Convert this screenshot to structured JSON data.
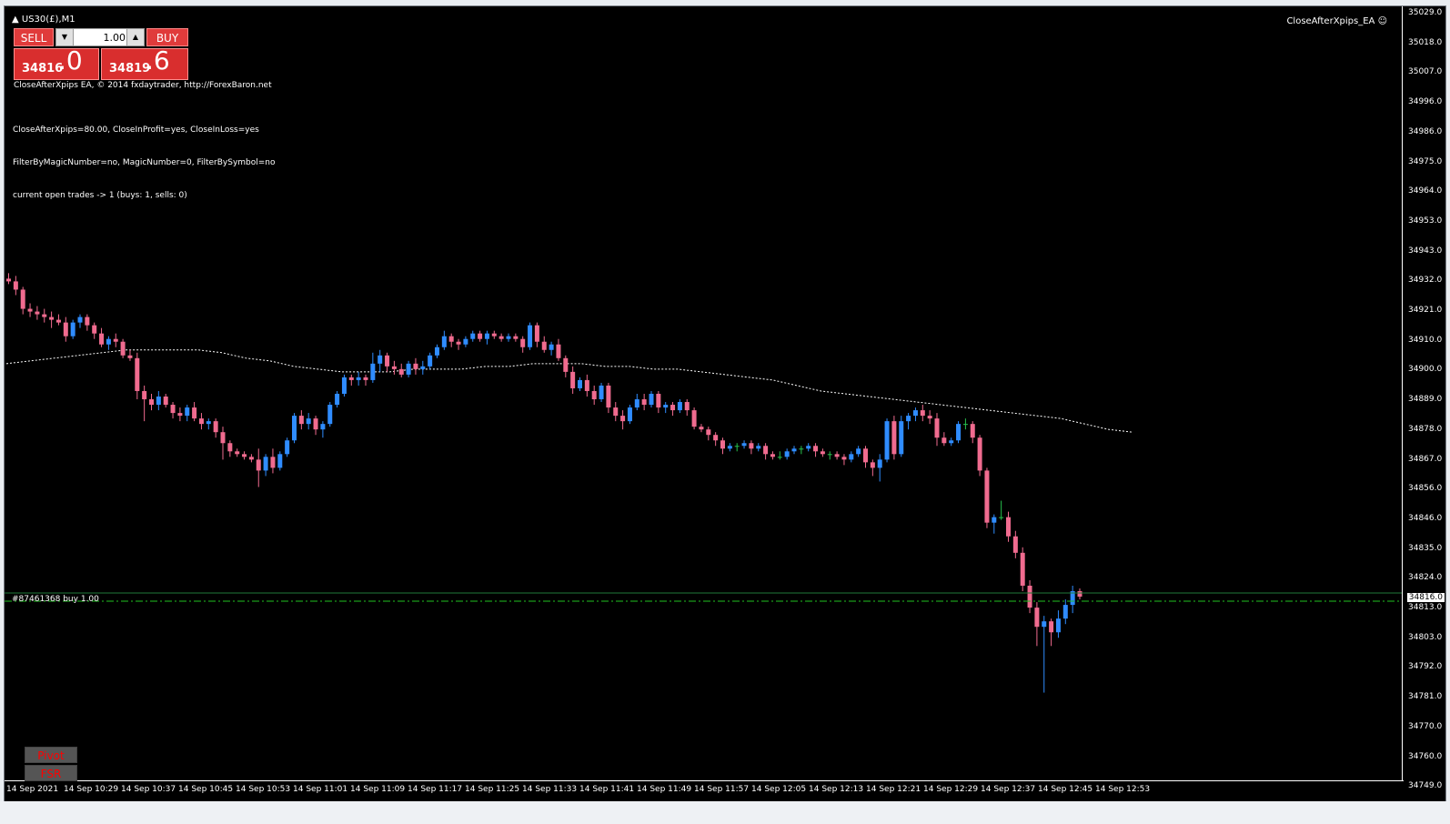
{
  "window": {
    "symbol_title": "US30(£),M1",
    "ea_label": "CloseAfterXpips_EA ☺"
  },
  "trade_panel": {
    "sell_label": "SELL",
    "buy_label": "BUY",
    "lot_value": "1.00",
    "sell_quote_main": "34816",
    "sell_quote_big": ".0",
    "buy_quote_main": "34819",
    "buy_quote_big": ".6"
  },
  "ea_info": {
    "line1": "CloseAfterXpips EA, © 2014 fxdaytrader, http://ForexBaron.net",
    "params1": "CloseAfterXpips=80.00, CloseInProfit=yes, CloseInLoss=yes",
    "params2": "FilterByMagicNumber=no, MagicNumber=0, FilterBySymbol=no",
    "params3": "current open trades -> 1 (buys: 1, sells: 0)"
  },
  "order_line": {
    "label": "#87461368 buy 1.00",
    "current_price": "34816.0"
  },
  "price_axis": [
    "35029.0",
    "35018.0",
    "35007.0",
    "34996.0",
    "34986.0",
    "34975.0",
    "34964.0",
    "34953.0",
    "34943.0",
    "34932.0",
    "34921.0",
    "34910.0",
    "34900.0",
    "34889.0",
    "34878.0",
    "34867.0",
    "34856.0",
    "34846.0",
    "34835.0",
    "34824.0",
    "34813.0",
    "34803.0",
    "34792.0",
    "34781.0",
    "34770.0",
    "34760.0",
    "34749.0"
  ],
  "time_axis": [
    "14 Sep 2021",
    "14 Sep 10:29",
    "14 Sep 10:37",
    "14 Sep 10:45",
    "14 Sep 10:53",
    "14 Sep 11:01",
    "14 Sep 11:09",
    "14 Sep 11:17",
    "14 Sep 11:25",
    "14 Sep 11:33",
    "14 Sep 11:41",
    "14 Sep 11:49",
    "14 Sep 11:57",
    "14 Sep 12:05",
    "14 Sep 12:13",
    "14 Sep 12:21",
    "14 Sep 12:29",
    "14 Sep 12:37",
    "14 Sep 12:45",
    "14 Sep 12:53"
  ],
  "indicators": {
    "pivot": "Pivot",
    "fsr": "FSR"
  },
  "colors": {
    "bull": "#2f8cff",
    "bear": "#f06b8f",
    "doji": "#27c24d",
    "order_line": "#20c020",
    "ma_line": "#ffffff"
  },
  "chart_data": {
    "type": "candlestick",
    "ohlc": [
      [
        34932,
        34934,
        34930,
        34931
      ],
      [
        34931,
        34933,
        34926,
        34928
      ],
      [
        34928,
        34929,
        34919,
        34921
      ],
      [
        34921,
        34923,
        34918,
        34920
      ],
      [
        34920,
        34922,
        34917,
        34919
      ],
      [
        34919,
        34921,
        34916,
        34918
      ],
      [
        34918,
        34920,
        34914,
        34917
      ],
      [
        34917,
        34919,
        34915,
        34916
      ],
      [
        34916,
        34918,
        34909,
        34911
      ],
      [
        34911,
        34917,
        34910,
        34916
      ],
      [
        34916,
        34919,
        34914,
        34918
      ],
      [
        34918,
        34919,
        34913,
        34915
      ],
      [
        34915,
        34916,
        34910,
        34912
      ],
      [
        34912,
        34914,
        34907,
        34908
      ],
      [
        34908,
        34911,
        34906,
        34910
      ],
      [
        34910,
        34912,
        34907,
        34909
      ],
      [
        34909,
        34910,
        34903,
        34904
      ],
      [
        34904,
        34906,
        34902,
        34903
      ],
      [
        34903,
        34905,
        34888,
        34891
      ],
      [
        34891,
        34893,
        34880,
        34888
      ],
      [
        34888,
        34890,
        34884,
        34886
      ],
      [
        34886,
        34891,
        34884,
        34889
      ],
      [
        34889,
        34890,
        34885,
        34886
      ],
      [
        34886,
        34887,
        34881,
        34883
      ],
      [
        34883,
        34885,
        34880,
        34882
      ],
      [
        34882,
        34886,
        34880,
        34885
      ],
      [
        34885,
        34887,
        34880,
        34881
      ],
      [
        34881,
        34883,
        34877,
        34879
      ],
      [
        34879,
        34881,
        34877,
        34880
      ],
      [
        34880,
        34881,
        34874,
        34876
      ],
      [
        34876,
        34878,
        34866,
        34872
      ],
      [
        34872,
        34873,
        34867,
        34869
      ],
      [
        34869,
        34870,
        34867,
        34868
      ],
      [
        34868,
        34869,
        34866,
        34867
      ],
      [
        34867,
        34868,
        34865,
        34866
      ],
      [
        34866,
        34870,
        34856,
        34862
      ],
      [
        34862,
        34868,
        34860,
        34867
      ],
      [
        34867,
        34870,
        34861,
        34863
      ],
      [
        34863,
        34869,
        34862,
        34868
      ],
      [
        34868,
        34874,
        34867,
        34873
      ],
      [
        34873,
        34883,
        34872,
        34882
      ],
      [
        34882,
        34884,
        34877,
        34879
      ],
      [
        34879,
        34883,
        34877,
        34881
      ],
      [
        34881,
        34882,
        34875,
        34877
      ],
      [
        34877,
        34880,
        34874,
        34879
      ],
      [
        34879,
        34887,
        34878,
        34886
      ],
      [
        34886,
        34891,
        34885,
        34890
      ],
      [
        34890,
        34897,
        34889,
        34896
      ],
      [
        34896,
        34897,
        34893,
        34895
      ],
      [
        34895,
        34898,
        34893,
        34896
      ],
      [
        34896,
        34897,
        34893,
        34895
      ],
      [
        34895,
        34905,
        34894,
        34901
      ],
      [
        34901,
        34906,
        34898,
        34904
      ],
      [
        34904,
        34905,
        34898,
        34900
      ],
      [
        34900,
        34902,
        34897,
        34899
      ],
      [
        34899,
        34901,
        34896,
        34897
      ],
      [
        34897,
        34902,
        34896,
        34901
      ],
      [
        34901,
        34903,
        34897,
        34899
      ],
      [
        34899,
        34902,
        34897,
        34900
      ],
      [
        34900,
        34905,
        34899,
        34904
      ],
      [
        34904,
        34908,
        34903,
        34907
      ],
      [
        34907,
        34913,
        34906,
        34911
      ],
      [
        34911,
        34912,
        34907,
        34909
      ],
      [
        34909,
        34910,
        34906,
        34908
      ],
      [
        34908,
        34911,
        34907,
        34910
      ],
      [
        34910,
        34913,
        34909,
        34912
      ],
      [
        34912,
        34913,
        34909,
        34910
      ],
      [
        34910,
        34913,
        34908,
        34912
      ],
      [
        34912,
        34913,
        34910,
        34911
      ],
      [
        34911,
        34912,
        34909,
        34910
      ],
      [
        34910,
        34912,
        34909,
        34911
      ],
      [
        34911,
        34912,
        34909,
        34910
      ],
      [
        34910,
        34911,
        34905,
        34907
      ],
      [
        34907,
        34916,
        34906,
        34915
      ],
      [
        34915,
        34916,
        34907,
        34909
      ],
      [
        34909,
        34911,
        34905,
        34906
      ],
      [
        34906,
        34909,
        34904,
        34908
      ],
      [
        34908,
        34910,
        34902,
        34903
      ],
      [
        34903,
        34904,
        34896,
        34898
      ],
      [
        34898,
        34900,
        34890,
        34892
      ],
      [
        34892,
        34896,
        34891,
        34895
      ],
      [
        34895,
        34897,
        34889,
        34891
      ],
      [
        34891,
        34893,
        34886,
        34888
      ],
      [
        34888,
        34894,
        34887,
        34893
      ],
      [
        34893,
        34894,
        34883,
        34885
      ],
      [
        34885,
        34887,
        34880,
        34882
      ],
      [
        34882,
        34884,
        34877,
        34880
      ],
      [
        34880,
        34886,
        34879,
        34885
      ],
      [
        34885,
        34890,
        34884,
        34888
      ],
      [
        34888,
        34890,
        34884,
        34886
      ],
      [
        34886,
        34891,
        34885,
        34890
      ],
      [
        34890,
        34891,
        34883,
        34885
      ],
      [
        34885,
        34887,
        34883,
        34886
      ],
      [
        34886,
        34887,
        34882,
        34884
      ],
      [
        34884,
        34888,
        34883,
        34887
      ],
      [
        34887,
        34888,
        34882,
        34884
      ],
      [
        34884,
        34885,
        34877,
        34878
      ],
      [
        34878,
        34879,
        34876,
        34877
      ],
      [
        34877,
        34878,
        34873,
        34875
      ],
      [
        34875,
        34876,
        34871,
        34873
      ],
      [
        34873,
        34874,
        34868,
        34870
      ],
      [
        34870,
        34872,
        34869,
        34871
      ],
      [
        34871,
        34872,
        34869,
        34871
      ],
      [
        34871,
        34873,
        34870,
        34872
      ],
      [
        34872,
        34873,
        34868,
        34870
      ],
      [
        34870,
        34872,
        34869,
        34871
      ],
      [
        34871,
        34872,
        34866,
        34868
      ],
      [
        34868,
        34869,
        34866,
        34867
      ],
      [
        34867,
        34869,
        34866,
        34867
      ],
      [
        34867,
        34870,
        34866,
        34869
      ],
      [
        34869,
        34871,
        34868,
        34870
      ],
      [
        34870,
        34871,
        34868,
        34870
      ],
      [
        34870,
        34872,
        34869,
        34871
      ],
      [
        34871,
        34872,
        34867,
        34869
      ],
      [
        34869,
        34870,
        34867,
        34868
      ],
      [
        34868,
        34869,
        34866,
        34868
      ],
      [
        34868,
        34869,
        34866,
        34867
      ],
      [
        34867,
        34868,
        34864,
        34866
      ],
      [
        34866,
        34869,
        34865,
        34868
      ],
      [
        34868,
        34871,
        34867,
        34870
      ],
      [
        34870,
        34871,
        34863,
        34865
      ],
      [
        34865,
        34866,
        34860,
        34863
      ],
      [
        34863,
        34868,
        34858,
        34866
      ],
      [
        34866,
        34881,
        34865,
        34880
      ],
      [
        34880,
        34882,
        34866,
        34868
      ],
      [
        34868,
        34882,
        34867,
        34880
      ],
      [
        34880,
        34883,
        34877,
        34882
      ],
      [
        34882,
        34885,
        34880,
        34884
      ],
      [
        34884,
        34886,
        34880,
        34882
      ],
      [
        34882,
        34884,
        34879,
        34881
      ],
      [
        34881,
        34883,
        34871,
        34874
      ],
      [
        34874,
        34876,
        34871,
        34872
      ],
      [
        34872,
        34874,
        34871,
        34873
      ],
      [
        34873,
        34880,
        34872,
        34879
      ],
      [
        34879,
        34881,
        34877,
        34879
      ],
      [
        34879,
        34880,
        34872,
        34874
      ],
      [
        34874,
        34875,
        34860,
        34862
      ],
      [
        34862,
        34863,
        34841,
        34843
      ],
      [
        34843,
        34846,
        34839,
        34845
      ],
      [
        34845,
        34851,
        34844,
        34845
      ],
      [
        34845,
        34847,
        34836,
        34838
      ],
      [
        34838,
        34840,
        34830,
        34832
      ],
      [
        34832,
        34834,
        34818,
        34820
      ],
      [
        34820,
        34822,
        34810,
        34812
      ],
      [
        34812,
        34814,
        34798,
        34805
      ],
      [
        34805,
        34809,
        34781,
        34807
      ],
      [
        34807,
        34808,
        34798,
        34803
      ],
      [
        34803,
        34811,
        34801,
        34808
      ],
      [
        34808,
        34815,
        34806,
        34813
      ],
      [
        34813,
        34820,
        34810,
        34818
      ],
      [
        34818,
        34819,
        34815,
        34816
      ]
    ],
    "ma_values": [
      34901,
      34902,
      34903,
      34904,
      34905,
      34906,
      34906,
      34906,
      34906,
      34905,
      34903,
      34902,
      34900,
      34899,
      34898,
      34898,
      34898,
      34899,
      34899,
      34899,
      34900,
      34900,
      34901,
      34901,
      34901,
      34900,
      34900,
      34899,
      34899,
      34898,
      34897,
      34896,
      34895,
      34893,
      34891,
      34890,
      34889,
      34888,
      34887,
      34886,
      34885,
      34884,
      34883,
      34882,
      34881,
      34879,
      34877,
      34876
    ],
    "order_level": 34816,
    "current_bid": 34816.0
  }
}
